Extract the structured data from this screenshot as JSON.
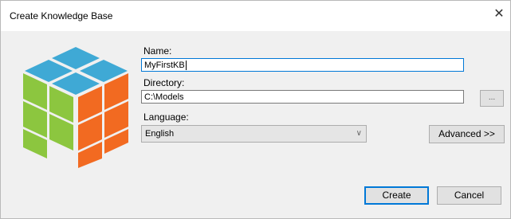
{
  "window": {
    "title": "Create Knowledge Base",
    "close_glyph": "✕"
  },
  "form": {
    "name_label": "Name:",
    "name_value": "MyFirstKB",
    "directory_label": "Directory:",
    "directory_value": "C:\\Models",
    "browse_label": "...",
    "language_label": "Language:",
    "language_value": "English",
    "advanced_label": "Advanced >>"
  },
  "buttons": {
    "create_label": "Create",
    "cancel_label": "Cancel"
  },
  "logo": {
    "name": "cube-icon",
    "colors": {
      "top": "#3fa9d5",
      "left": "#8cc63f",
      "right": "#f26a21"
    }
  }
}
